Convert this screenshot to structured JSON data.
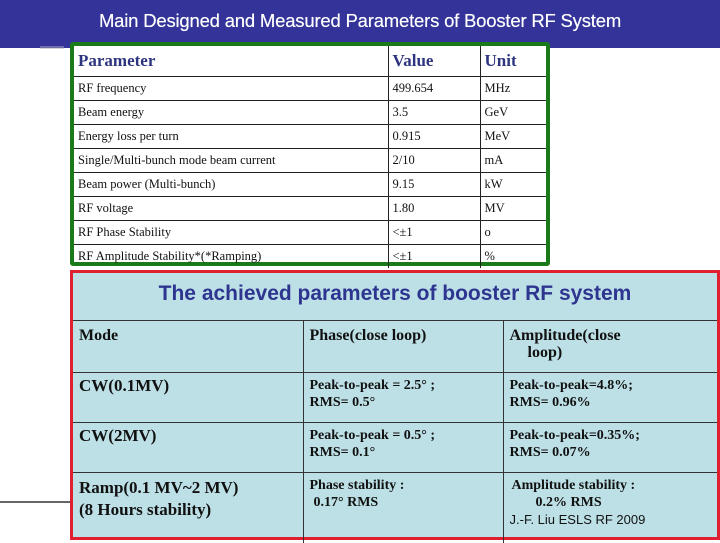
{
  "header": {
    "title": "Main Designed and Measured Parameters of Booster RF System"
  },
  "designed_table": {
    "headers": [
      "Parameter",
      "Value",
      "Unit"
    ],
    "rows": [
      [
        "RF frequency",
        "499.654",
        "MHz"
      ],
      [
        "Beam energy",
        "3.5",
        "GeV"
      ],
      [
        "Energy loss per turn",
        "0.915",
        "MeV"
      ],
      [
        "Single/Multi-bunch mode beam current",
        "2/10",
        "mA"
      ],
      [
        "Beam power (Multi-bunch)",
        "9.15",
        "kW"
      ],
      [
        "RF voltage",
        "1.80",
        "MV"
      ],
      [
        "RF Phase Stability",
        "<±1",
        "o"
      ],
      [
        "RF Amplitude Stability*(*Ramping)",
        "<±1",
        "%"
      ]
    ]
  },
  "achieved_table": {
    "title": "The achieved parameters of booster RF system",
    "headers": {
      "mode": "Mode",
      "phase": "Phase(close loop)",
      "amplitude_line1": "Amplitude(close",
      "amplitude_line2": "loop)"
    },
    "rows": [
      {
        "mode_line1": "CW(0.1MV)",
        "mode_line2": "",
        "phase_line1": "Peak-to-peak = 2.5° ;",
        "phase_line2": "RMS= 0.5°",
        "amp_line1": "Peak-to-peak=4.8%;",
        "amp_line2": "RMS= 0.96%"
      },
      {
        "mode_line1": "CW(2MV)",
        "mode_line2": "",
        "phase_line1": "Peak-to-peak = 0.5° ;",
        "phase_line2": "RMS= 0.1°",
        "amp_line1": "Peak-to-peak=0.35%;",
        "amp_line2": "RMS= 0.07%"
      },
      {
        "mode_line1": "Ramp(0.1 MV~2 MV)",
        "mode_line2": "(8 Hours stability)",
        "phase_line1": "Phase stability :",
        "phase_line2": "0.17°   RMS",
        "amp_line1": "Amplitude stability :",
        "amp_line2": "0.2% RMS"
      }
    ],
    "credit": "J.-F. Liu ESLS RF 2009"
  },
  "colors": {
    "title_bar": "#333399",
    "top_table_border": "#1a7a1a",
    "bottom_table_border": "#e02030",
    "bottom_table_bg": "#bde0e6",
    "header_text": "#2e3580"
  }
}
